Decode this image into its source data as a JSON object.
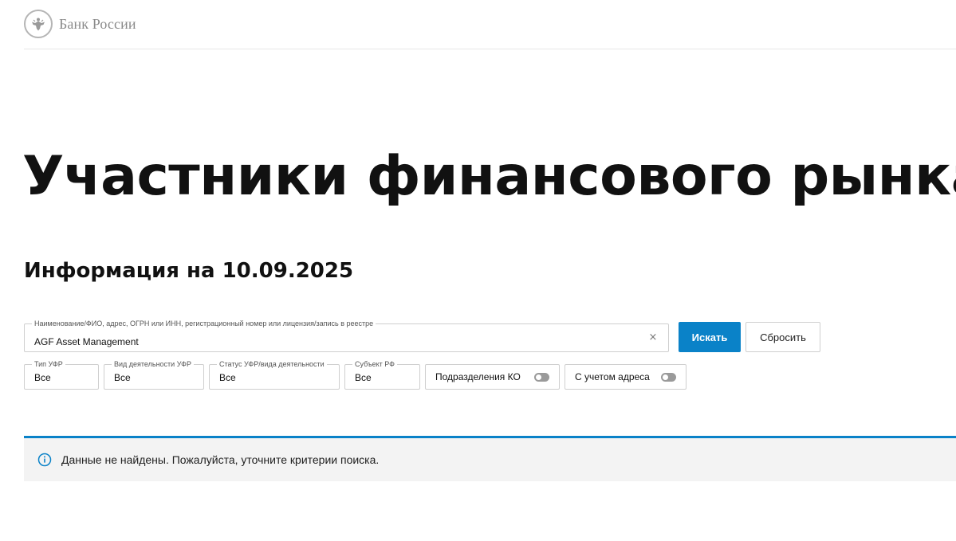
{
  "header": {
    "logo_text": "Банк России",
    "logo_icon": "double-headed-eagle-icon"
  },
  "page": {
    "title": "Участники финансового рынка",
    "subtitle": "Информация на 10.09.2025"
  },
  "search": {
    "legend": "Наименование/ФИО, адрес, ОГРН или ИНН, регистрационный номер или лицензия/запись в реестре",
    "value": "AGF Asset Management",
    "clear_icon": "×",
    "submit_label": "Искать",
    "reset_label": "Сбросить"
  },
  "filters": {
    "type": {
      "legend": "Тип УФР",
      "value": "Все"
    },
    "activity": {
      "legend": "Вид деятельности УФР",
      "value": "Все"
    },
    "status": {
      "legend": "Статус УФР/вида деятельности",
      "value": "Все"
    },
    "region": {
      "legend": "Субъект РФ",
      "value": "Все"
    }
  },
  "toggles": {
    "branches": {
      "label": "Подразделения КО",
      "on": false
    },
    "address": {
      "label": "С учетом адреса",
      "on": false
    }
  },
  "result": {
    "icon": "info-icon",
    "message": "Данные не найдены. Пожалуйста, уточните критерии поиска."
  },
  "colors": {
    "accent": "#0a82c8",
    "notice_bg": "#f3f3f3",
    "border": "#cfcfcf"
  }
}
